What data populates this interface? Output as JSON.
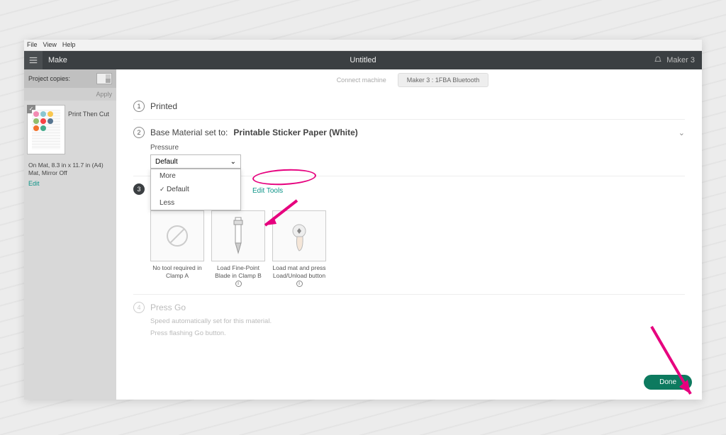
{
  "menu": {
    "file": "File",
    "view": "View",
    "help": "Help"
  },
  "topbar": {
    "make": "Make",
    "title": "Untitled",
    "device": "Maker 3"
  },
  "connect": {
    "connect": "Connect machine",
    "device": "Maker 3 : 1FBA Bluetooth"
  },
  "sidebar": {
    "copies_label": "Project copies:",
    "apply": "Apply",
    "mode": "Print Then Cut",
    "matinfo": "On Mat, 8.3 in x 11.7 in (A4) Mat, Mirror Off",
    "edit": "Edit"
  },
  "step1": {
    "title": "Printed"
  },
  "step2": {
    "title_prefix": "Base Material set to:",
    "material": "Printable Sticker Paper (White)",
    "pressure_label": "Pressure",
    "selected": "Default",
    "options": {
      "more": "More",
      "default": "Default",
      "less": "Less"
    }
  },
  "step3": {
    "edit_tools": "Edit Tools",
    "card_a": "No tool required in Clamp A",
    "card_b": "Load Fine-Point Blade in Clamp B",
    "card_c": "Load mat and press Load/Unload button"
  },
  "step4": {
    "title": "Press Go",
    "line1": "Speed automatically set for this material.",
    "line2": "Press flashing Go button."
  },
  "done": "Done",
  "thumb_colors": [
    "#f28ab2",
    "#8ac6d1",
    "#f9c74f",
    "#90be6d",
    "#f94144",
    "#577590",
    "#f3722c",
    "#43aa8b"
  ]
}
